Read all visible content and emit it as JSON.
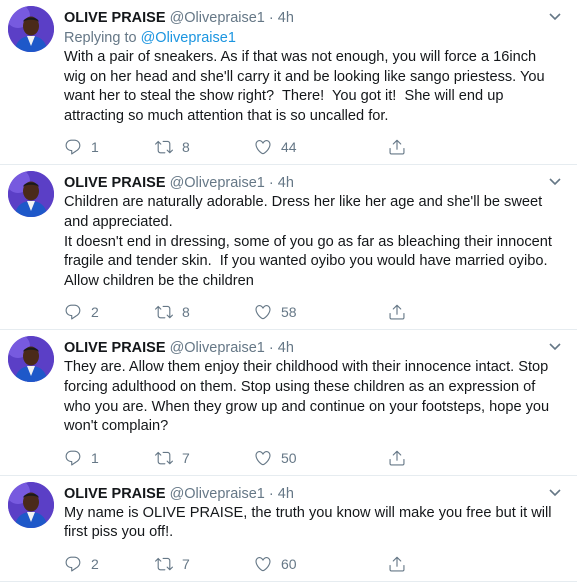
{
  "tweets": [
    {
      "name": "OLIVE PRAISE",
      "handle": "@Olivepraise1",
      "separator": "·",
      "time": "4h",
      "replying_prefix": "Replying to ",
      "replying_to": "@Olivepraise1",
      "body": "With a pair of sneakers. As if that was not enough, you will force a 16inch wig on her head and she'll carry it and be looking like sango priestess. You want her to steal the show right?  There!  You got it!  She will end up attracting so much attention that is so uncalled for.",
      "replies": "1",
      "retweets": "8",
      "likes": "44"
    },
    {
      "name": "OLIVE PRAISE",
      "handle": "@Olivepraise1",
      "separator": "·",
      "time": "4h",
      "body": "Children are naturally adorable. Dress her like her age and she'll be sweet and appreciated.\nIt doesn't end in dressing, some of you go as far as bleaching their innocent fragile and tender skin.  If you wanted oyibo you would have married oyibo. Allow children be the children",
      "replies": "2",
      "retweets": "8",
      "likes": "58"
    },
    {
      "name": "OLIVE PRAISE",
      "handle": "@Olivepraise1",
      "separator": "·",
      "time": "4h",
      "body": "They are. Allow them enjoy their childhood with their innocence intact. Stop forcing adulthood on them. Stop using these children as an expression of who you are. When they grow up and continue on your footsteps, hope you won't complain?",
      "replies": "1",
      "retweets": "7",
      "likes": "50"
    },
    {
      "name": "OLIVE PRAISE",
      "handle": "@Olivepraise1",
      "separator": "·",
      "time": "4h",
      "body": "My name is OLIVE PRAISE, the truth you know will make you free but it will first piss you off!.",
      "replies": "2",
      "retweets": "7",
      "likes": "60"
    }
  ],
  "icons": {
    "reply": "reply-icon",
    "retweet": "retweet-icon",
    "like": "heart-icon",
    "share": "share-icon",
    "menu": "chevron-down-icon"
  },
  "colors": {
    "text": "#14171a",
    "secondary": "#657786",
    "link": "#1b95e0",
    "divider": "#e6ecf0"
  }
}
